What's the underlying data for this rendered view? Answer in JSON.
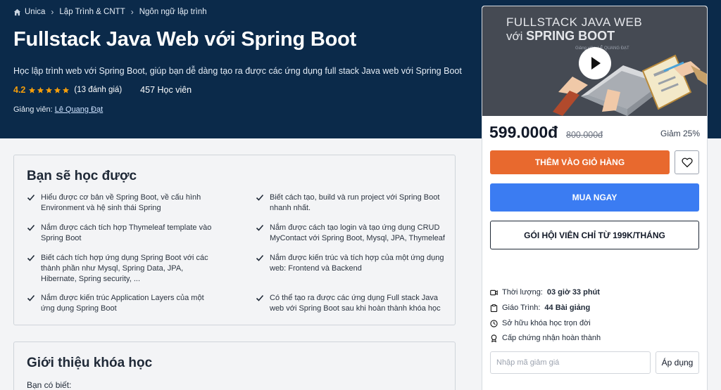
{
  "breadcrumb": [
    "Unica",
    "Lập Trình & CNTT",
    "Ngôn ngữ lập trình"
  ],
  "course": {
    "title": "Fullstack Java Web với Spring Boot",
    "subtitle": "Học lập trình web với Spring Boot, giúp bạn dễ dàng tạo ra được các ứng dụng full stack Java web với Spring Boot",
    "rating": "4.2",
    "rating_count": "(13 đánh giá)",
    "students": "457 Học viên",
    "instructor_label": "Giảng viên:",
    "instructor_name": "Lê Quang Đạt"
  },
  "learn": {
    "title": "Bạn sẽ học được",
    "items": [
      "Hiểu được cơ bản về Spring Boot, về cấu hình Environment và hệ sinh thái Spring",
      "Biết cách tạo, build và run project với Spring Boot nhanh nhất.",
      "Nắm được cách tích hợp Thymeleaf template vào Spring Boot",
      "Nắm được cách tạo login và tạo ứng dụng CRUD MyContact với Spring Boot, Mysql, JPA, Thymeleaf",
      "Biết cách tích hợp ứng dụng Spring Boot với các thành phần như Mysql, Spring Data, JPA, Hibernate, Spring security, ...",
      "Nắm được kiến trúc và tích hợp của một ứng dụng web: Frontend và Backend",
      "Nắm được kiến trúc Application Layers của một ứng dụng Spring Boot",
      "Có thể tạo ra được các ứng dụng Full stack Java web với Spring Boot sau khi hoàn thành khóa học"
    ]
  },
  "intro": {
    "title": "Giới thiệu khóa học",
    "subtitle": "Bạn có biết:"
  },
  "thumbnail": {
    "line1": "FULLSTACK JAVA WEB",
    "line2_prefix": "với",
    "line2_bold": "SPRING BOOT",
    "small": "Giảng viên: LÊ QUANG ĐẠT"
  },
  "pricing": {
    "price": "599.000đ",
    "old_price": "800.000đ",
    "discount": "Giảm 25%"
  },
  "buttons": {
    "add_to_cart": "THÊM VÀO GIỎ HÀNG",
    "buy_now": "MUA NGAY",
    "membership": "GÓI HỘI VIÊN CHỈ TỪ 199K/THÁNG",
    "apply": "Áp dụng"
  },
  "features": {
    "duration_label": "Thời lượng:",
    "duration_value": "03 giờ 33 phút",
    "curriculum_label": "Giáo Trình:",
    "curriculum_value": "44 Bài giảng",
    "lifetime": "Sở hữu khóa học trọn đời",
    "certificate": "Cấp chứng nhận hoàn thành"
  },
  "coupon": {
    "placeholder": "Nhập mã giảm giá"
  },
  "colors": {
    "hero_bg": "#0b2a4a",
    "star": "#f59e0b",
    "cart_button": "#e8692e",
    "buy_button": "#3b7cf2"
  }
}
